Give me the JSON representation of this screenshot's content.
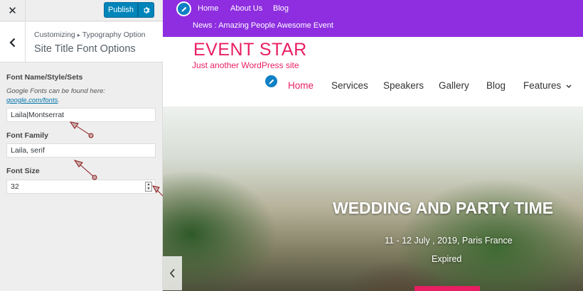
{
  "customizer": {
    "close_icon": "close-icon",
    "publish_label": "Publish",
    "gear_icon": "gear-icon",
    "back_icon": "chevron-left-icon",
    "breadcrumb": {
      "root": "Customizing",
      "separator": "▸",
      "section": "Typography Option"
    },
    "panel_title": "Site Title Font Options",
    "controls": {
      "font_name": {
        "label": "Font Name/Style/Sets",
        "description": "Google Fonts can be found here:",
        "link_text": "google.com/fonts",
        "link_suffix": ".",
        "value": "Laila|Montserrat"
      },
      "font_family": {
        "label": "Font Family",
        "value": "Laila, serif"
      },
      "font_size": {
        "label": "Font Size",
        "value": "32"
      }
    },
    "accent_color": "#0085ba"
  },
  "preview": {
    "top_nav": [
      "Home",
      "About Us",
      "Blog"
    ],
    "news": "News : Amazing People Awesome Event",
    "site_title": "EVENT STAR",
    "tagline": "Just another WordPress site",
    "main_nav": [
      "Home",
      "Services",
      "Speakers",
      "Gallery",
      "Blog",
      "Features"
    ],
    "features_dropdown_icon": "chevron-down-icon",
    "hero": {
      "title": "WEDDING AND PARTY TIME",
      "date": "11 - 12 July , 2019, Paris France",
      "status": "Expired"
    },
    "colors": {
      "top_bar": "#8e2ee0",
      "brand_pink": "#e91e63",
      "edit_shortcut": "#0f80c4"
    }
  }
}
